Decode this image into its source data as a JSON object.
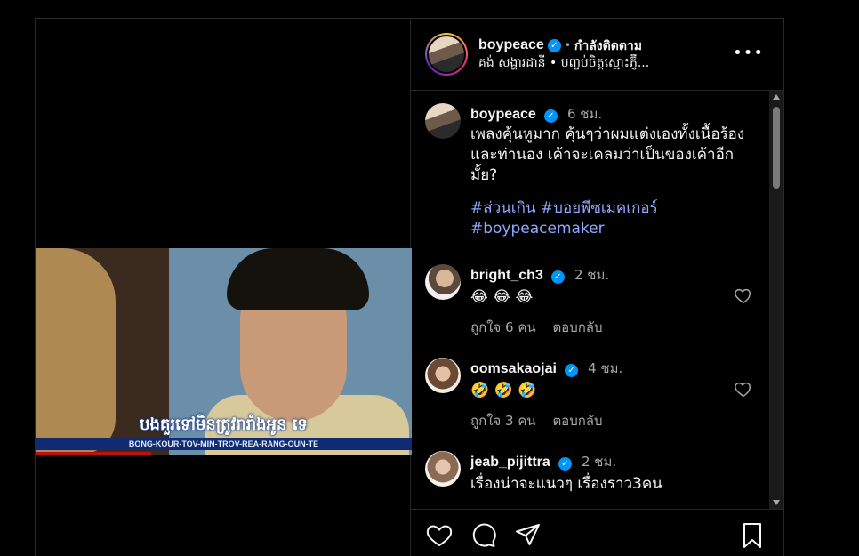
{
  "header": {
    "username": "boypeace",
    "separator": "•",
    "follow_status": "กำลังติดตาม",
    "subtitle": "គង់ សង្ហារដានី • បញ្ចប់ចិត្តស្មោះភ្ញ៊ី...",
    "more_label": "•••"
  },
  "video": {
    "subtitle_khmer": "បងគួរទៅមិនត្រូវរារាំងអូន ទេ",
    "subtitle_latin": "BONG-KOUR-TOV-MIN-TROV-REA-RANG-OUN-TE"
  },
  "caption": {
    "username": "boypeace",
    "time": "6 ชม.",
    "text": "เพลงคุ้นหูมาก คุ้นๆว่าผมแต่งเองทั้งเนื้อร้องและท่านอง  เค้าจะเคลมว่าเป็นของเค้าอีกมั้ย?",
    "hashtags": [
      "#ส่วนเกิน",
      "#บอยพีซเมคเกอร์",
      "#boypeacemaker"
    ]
  },
  "comments": [
    {
      "username": "bright_ch3",
      "time": "2 ชม.",
      "text": "😂 😂 😂",
      "likes": "ถูกใจ 6 คน",
      "reply": "ตอบกลับ"
    },
    {
      "username": "oomsakaojai",
      "time": "4 ชม.",
      "text": "🤣 🤣 🤣",
      "likes": "ถูกใจ 3 คน",
      "reply": "ตอบกลับ"
    },
    {
      "username": "jeab_pijittra",
      "time": "2 ชม.",
      "text": "เรื่องน่าจะแนวๆ เรื่องราว3คน",
      "likes": "",
      "reply": ""
    }
  ],
  "verified_mark": "✓",
  "icons": [
    "heart-icon",
    "comment-icon",
    "share-icon",
    "save-icon",
    "more-icon",
    "verified-icon"
  ],
  "colors": {
    "accent": "#0095f6",
    "hashtag": "#8ea8ff",
    "muted": "#a8a8a8",
    "background": "#000000"
  }
}
